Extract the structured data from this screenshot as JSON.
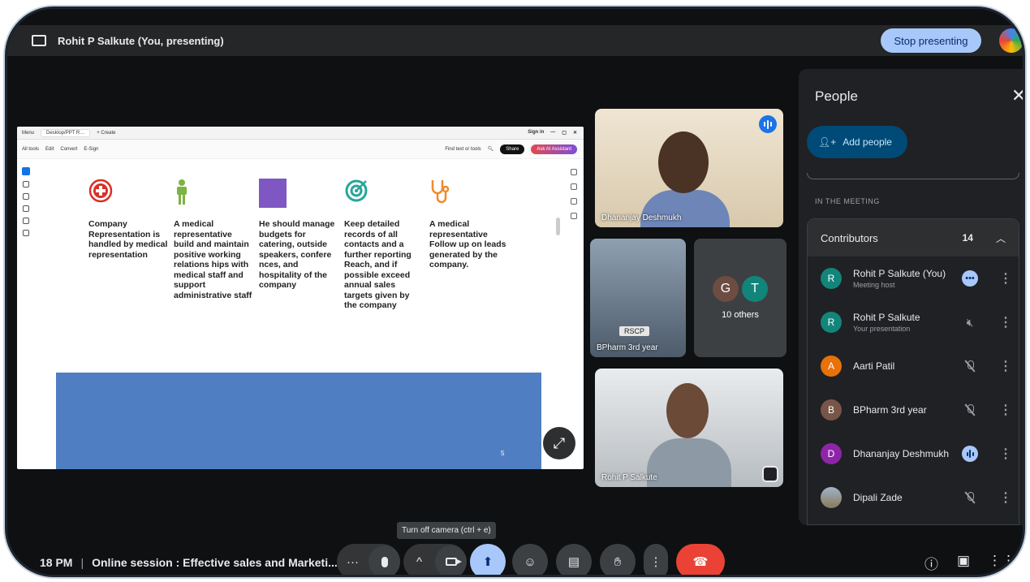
{
  "topbar": {
    "title": "Rohit P Salkute (You, presenting)",
    "stop_label": "Stop presenting"
  },
  "shared_screen": {
    "browser_tab": "Desktop/PPT R…",
    "browser_newtab": "+ Create",
    "browser_signin": "Sign in",
    "menu_label": "Menu",
    "acrobat_menu": [
      "All tools",
      "Edit",
      "Convert",
      "E-Sign"
    ],
    "find_label": "Find text or tools",
    "share_label": "Share",
    "ai_label": "Ask AI Assistant",
    "columns": [
      {
        "icon": "red-cross-icon",
        "text": "Company Representation is handled by medical representation"
      },
      {
        "icon": "medical-rep-icon",
        "text": "A medical representative build and maintain positive working relations hips with medical staff and support administrative staff"
      },
      {
        "icon": "purple-square-icon",
        "text": "He should manage budgets for catering, outside speakers, confere nces, and hospitality of the company"
      },
      {
        "icon": "target-icon",
        "text": "Keep detailed records of all contacts and a further reporting Reach, and if possible exceed annual sales targets given by the company"
      },
      {
        "icon": "stethoscope-icon",
        "text": "A medical representative Follow up on leads generated by the company."
      }
    ],
    "page_number": "5"
  },
  "tiles": {
    "dhananjay": "Dhananjay Deshmukh",
    "classroom": "BPharm 3rd year",
    "classroom_sign": "RSCP",
    "others_label": "10 others",
    "others_avatars": [
      "G",
      "T"
    ],
    "rohit": "Rohit P Salkute"
  },
  "panel": {
    "title": "People",
    "add_people": "Add people",
    "section": "IN THE MEETING",
    "group": "Contributors",
    "count": "14",
    "participants": [
      {
        "initial": "R",
        "name": "Rohit P Salkute (You)",
        "sub": "Meeting host",
        "color": "#12857a",
        "state": "more-options"
      },
      {
        "initial": "R",
        "name": "Rohit P Salkute",
        "sub": "Your presentation",
        "color": "#12857a",
        "state": "presentation-muted"
      },
      {
        "initial": "A",
        "name": "Aarti Patil",
        "sub": "",
        "color": "#e8710a",
        "state": "muted"
      },
      {
        "initial": "B",
        "name": "BPharm 3rd year",
        "sub": "",
        "color": "#795548",
        "state": "muted"
      },
      {
        "initial": "D",
        "name": "Dhananjay Deshmukh",
        "sub": "",
        "color": "#8e24aa",
        "state": "speaking"
      },
      {
        "initial": "",
        "name": "Dipali Zade",
        "sub": "",
        "color": "#8a7a5a",
        "state": "muted"
      }
    ]
  },
  "bottom": {
    "time": "18 PM",
    "separator": "|",
    "meeting_title": "Online session : Effective sales and Marketi...",
    "tooltip": "Turn off camera (ctrl + e)"
  },
  "colors": {
    "accent": "#a8c7fa",
    "end_call": "#ea4335",
    "background": "#0f1012",
    "panel": "#202124"
  }
}
